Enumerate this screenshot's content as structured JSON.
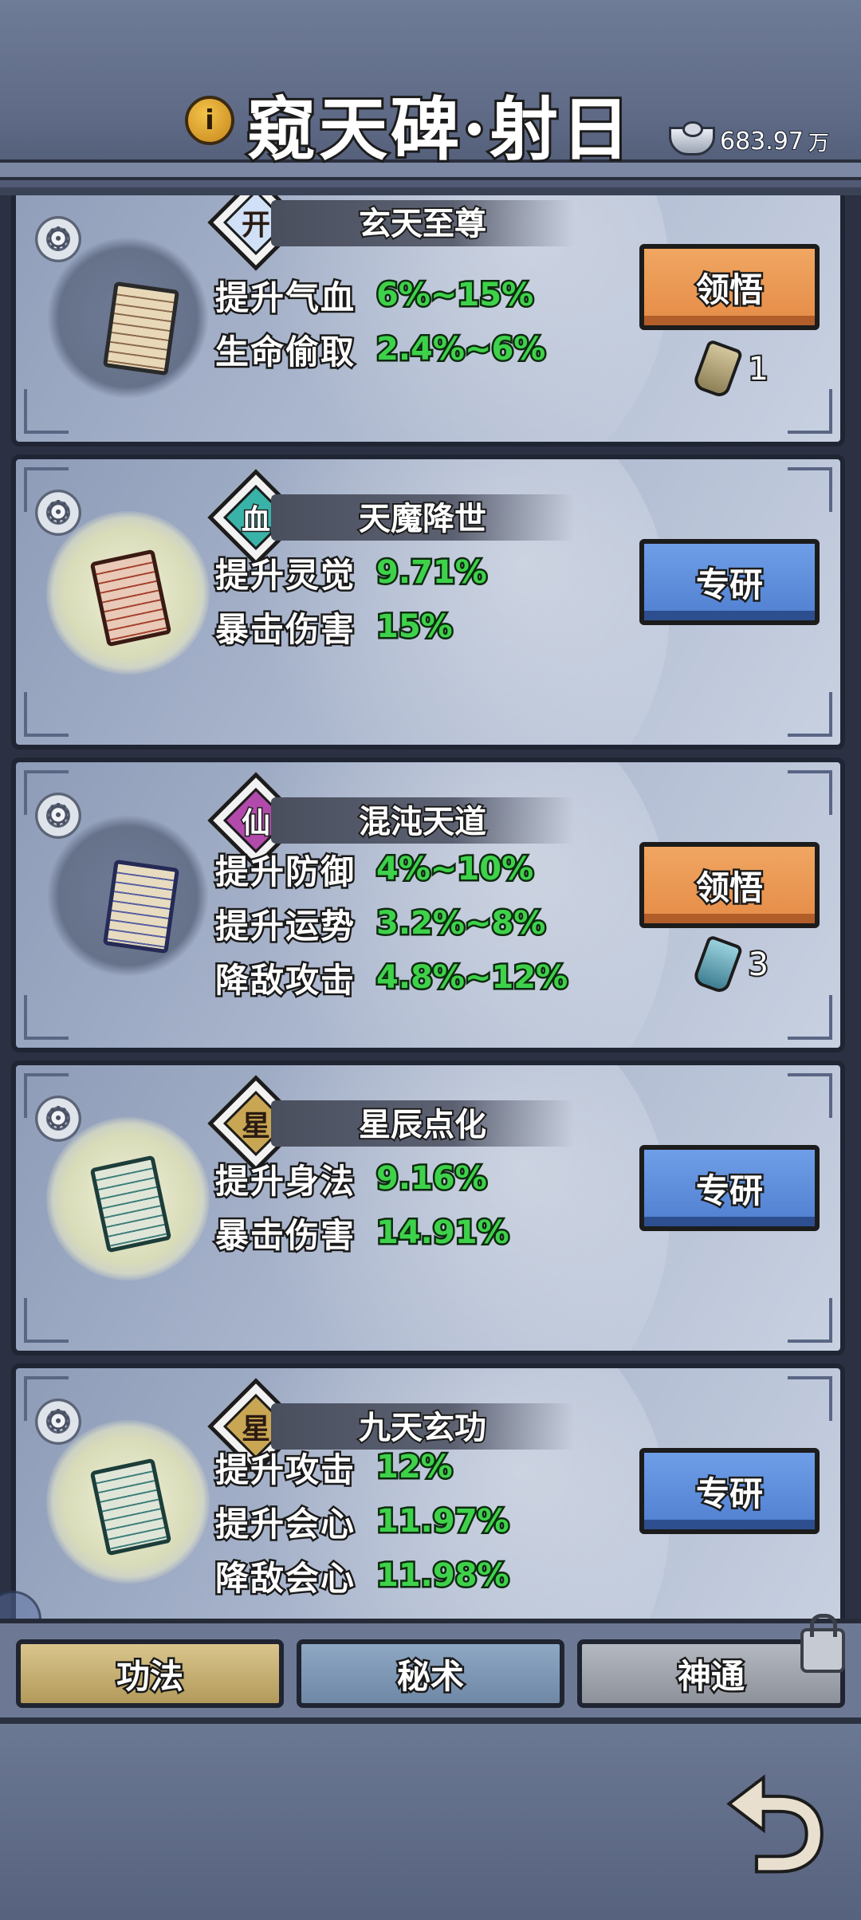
{
  "header": {
    "title": "窥天碑·射日",
    "info_icon": "i",
    "currency": {
      "amount": "683.97",
      "unit": "万",
      "icon": "silver-ingot-icon"
    }
  },
  "cards": [
    {
      "badge": "开",
      "badge_color": "#4f7fcf",
      "name": "玄天至尊",
      "stats": [
        {
          "k": "提升气血",
          "v": "6%~15%"
        },
        {
          "k": "生命偷取",
          "v": "2.4%~6%"
        }
      ],
      "button": "领悟",
      "button_style": "orange",
      "cost": {
        "icon": "scroll-token-icon",
        "amount": "1"
      }
    },
    {
      "badge": "血",
      "badge_color": "#2ea8a0",
      "name": "天魔降世",
      "stats": [
        {
          "k": "提升灵觉",
          "v": "9.71%"
        },
        {
          "k": "暴击伤害",
          "v": "15%"
        }
      ],
      "button": "专研",
      "button_style": "blue"
    },
    {
      "badge": "仙",
      "badge_color": "#a43aa0",
      "name": "混沌天道",
      "stats": [
        {
          "k": "提升防御",
          "v": "4%~10%"
        },
        {
          "k": "提升运势",
          "v": "3.2%~8%"
        },
        {
          "k": "降敌攻击",
          "v": "4.8%~12%"
        }
      ],
      "button": "领悟",
      "button_style": "orange",
      "cost": {
        "icon": "scroll-token-icon",
        "amount": "3"
      }
    },
    {
      "badge": "星",
      "badge_color": "#b7953f",
      "name": "星辰点化",
      "stats": [
        {
          "k": "提升身法",
          "v": "9.16%"
        },
        {
          "k": "暴击伤害",
          "v": "14.91%"
        }
      ],
      "button": "专研",
      "button_style": "blue"
    },
    {
      "badge": "星",
      "badge_color": "#b7953f",
      "name": "九天玄功",
      "stats": [
        {
          "k": "提升攻击",
          "v": "12%"
        },
        {
          "k": "提升会心",
          "v": "11.97%"
        },
        {
          "k": "降敌会心",
          "v": "11.98%"
        }
      ],
      "button": "专研",
      "button_style": "blue"
    }
  ],
  "tabs": [
    "功法",
    "秘术",
    "神通"
  ],
  "icons": {
    "back": "back-arrow-icon",
    "lock": "lock-icon",
    "settings": "gear-icon"
  }
}
